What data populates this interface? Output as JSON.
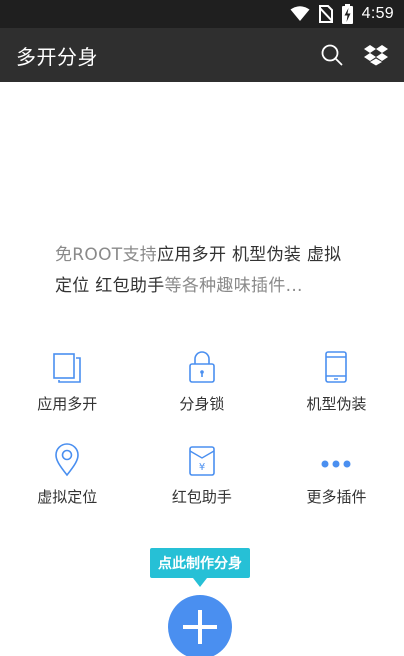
{
  "status_bar": {
    "time": "4:59",
    "icons": [
      "wifi-icon",
      "no-sim-icon",
      "battery-charging-icon"
    ]
  },
  "app_bar": {
    "title": "多开分身",
    "actions": [
      "search-icon",
      "dropbox-icon"
    ]
  },
  "intro": {
    "line1_muted": "免ROOT支持",
    "line1_strong": "应用多开 机型伪装 虚拟",
    "line2_strong": "定位 红包助手",
    "line2_muted": "等各种趣味插件..."
  },
  "features": [
    {
      "label": "应用多开",
      "icon": "multi-window-icon"
    },
    {
      "label": "分身锁",
      "icon": "lock-icon"
    },
    {
      "label": "机型伪装",
      "icon": "phone-icon"
    },
    {
      "label": "虚拟定位",
      "icon": "location-pin-icon"
    },
    {
      "label": "红包助手",
      "icon": "red-envelope-icon"
    },
    {
      "label": "更多插件",
      "icon": "more-dots-icon"
    }
  ],
  "create_tip": "点此制作分身",
  "fab": {
    "icon": "plus-icon"
  },
  "colors": {
    "accent": "#4a8ff0",
    "tip": "#26c0d6",
    "appbar": "#2f2f2f",
    "statusbar": "#1f1f1f"
  }
}
